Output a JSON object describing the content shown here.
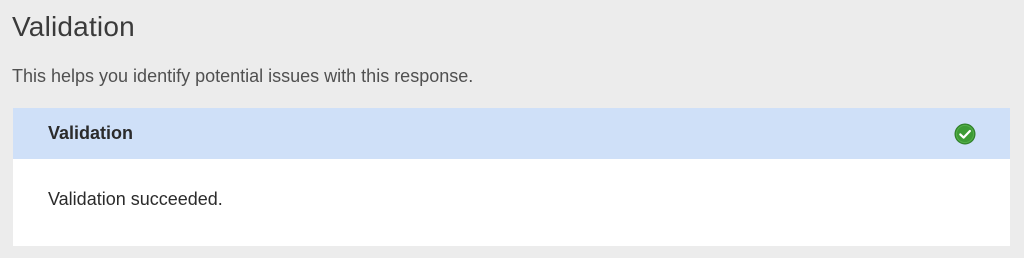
{
  "section": {
    "title": "Validation",
    "description": "This helps you identify potential issues with this response."
  },
  "panel": {
    "header_title": "Validation",
    "status_icon": "check-circle-icon",
    "status": "success",
    "message": "Validation succeeded."
  },
  "colors": {
    "page_background": "#ececec",
    "header_background": "#cfe0f8",
    "success_green": "#3d9b35"
  }
}
